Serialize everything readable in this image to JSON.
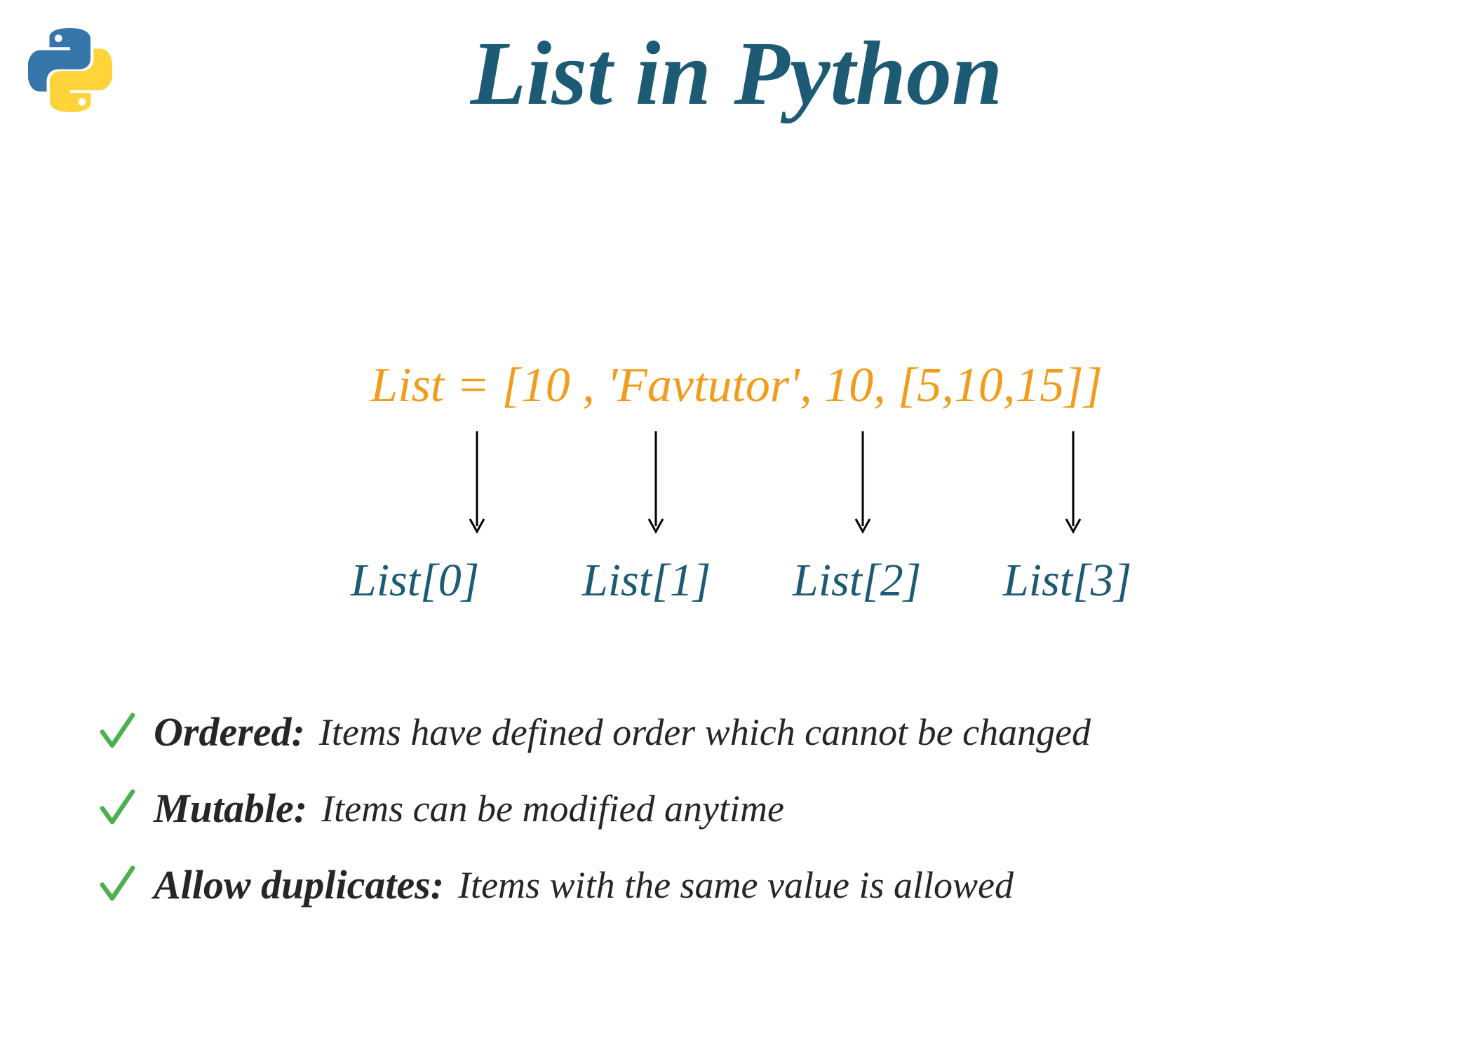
{
  "title": "List in Python",
  "list_definition": "List = [10 , 'Favtutor', 10, [5,10,15]]",
  "index_labels": [
    "List[0]",
    "List[1]",
    "List[2]",
    "List[3]"
  ],
  "features": [
    {
      "name": "Ordered:",
      "description": "Items have defined order which cannot be changed"
    },
    {
      "name": "Mutable:",
      "description": "Items can be modified anytime"
    },
    {
      "name": "Allow duplicates:",
      "description": "Items with the same value is  allowed"
    }
  ],
  "colors": {
    "title": "#1d5a73",
    "definition": "#f29c1e",
    "check": "#4caf50",
    "text": "#262626"
  }
}
